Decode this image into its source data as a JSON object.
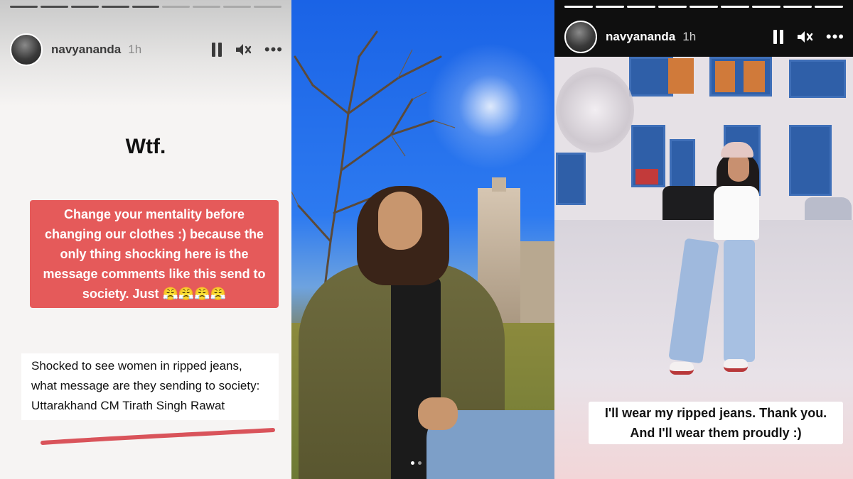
{
  "stories": [
    {
      "username": "navyananda",
      "time": "1h",
      "progress": {
        "segments_total": 9,
        "segments_done": 5
      },
      "headline_text": "Wtf.",
      "reply_text": "Change your mentality before changing our clothes :) because the only thing shocking here is the message comments like this send to society. Just 😤😤😤😤",
      "quote_text": "Shocked to see women in ripped jeans, what message are they sending to society: Uttarakhand CM Tirath Singh Rawat",
      "colors": {
        "reply_bg": "#e55a5a",
        "underline": "#d9535a"
      }
    },
    {
      "carousel": {
        "dots_total": 2,
        "active": 0
      }
    },
    {
      "username": "navyananda",
      "time": "1h",
      "progress": {
        "segments_total": 9,
        "segments_done": 9
      },
      "caption_text": "I'll wear my ripped jeans. Thank you. And I'll wear them proudly :)"
    }
  ],
  "icons": {
    "pause": "pause-icon",
    "mute": "volume-mute-icon",
    "more": "more-options-icon"
  },
  "labels": {
    "more_glyph": "•••"
  }
}
